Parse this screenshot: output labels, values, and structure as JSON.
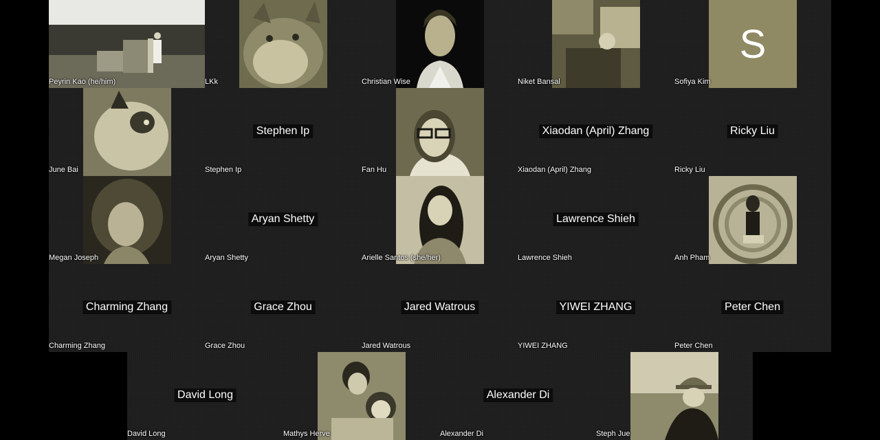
{
  "participants": [
    {
      "name": "Peyrin Kao (he/him)",
      "type": "video",
      "thumb": "stage"
    },
    {
      "name": "LKk",
      "type": "video",
      "thumb": "cat"
    },
    {
      "name": "Christian Wise",
      "type": "video",
      "thumb": "person-dark"
    },
    {
      "name": "Niket Bansal",
      "type": "video",
      "thumb": "outdoor"
    },
    {
      "name": "Sofiya Kim",
      "type": "avatar",
      "initial": "S"
    },
    {
      "name": "June Bai",
      "type": "video",
      "thumb": "cat-light"
    },
    {
      "name": "Stephen Ip",
      "type": "name",
      "display": "Stephen Ip"
    },
    {
      "name": "Fan Hu",
      "type": "video",
      "thumb": "person-glasses"
    },
    {
      "name": "Xiaodan (April) Zhang",
      "type": "name",
      "display": "Xiaodan (April) Zhang"
    },
    {
      "name": "Ricky Liu",
      "type": "name",
      "display": "Ricky Liu"
    },
    {
      "name": "Megan Joseph",
      "type": "video",
      "thumb": "person-curly"
    },
    {
      "name": "Aryan Shetty",
      "type": "name",
      "display": "Aryan Shetty"
    },
    {
      "name": "Arielle Santos (she/her)",
      "type": "video",
      "thumb": "person-hair"
    },
    {
      "name": "Lawrence Shieh",
      "type": "name",
      "display": "Lawrence Shieh"
    },
    {
      "name": "Anh Pham",
      "type": "video",
      "thumb": "person-seated"
    },
    {
      "name": "Charming Zhang",
      "type": "name",
      "display": "Charming Zhang"
    },
    {
      "name": "Grace Zhou",
      "type": "name",
      "display": "Grace Zhou"
    },
    {
      "name": "Jared Watrous",
      "type": "name",
      "display": "Jared Watrous"
    },
    {
      "name": "YIWEI ZHANG",
      "type": "name",
      "display": "YIWEI ZHANG"
    },
    {
      "name": "Peter Chen",
      "type": "name",
      "display": "Peter Chen"
    }
  ],
  "bottom_row": [
    {
      "name": "David Long",
      "type": "name",
      "display": "David Long"
    },
    {
      "name": "Mathys Herve",
      "type": "video",
      "thumb": "person-plush"
    },
    {
      "name": "Alexander Di",
      "type": "name",
      "display": "Alexander Di"
    },
    {
      "name": "Steph Jue",
      "type": "video",
      "thumb": "person-hat"
    }
  ],
  "colors": {
    "avatar_bg": "#8f8a63",
    "tile_bg": "#1e1e1e",
    "name_bg": "#0c0c0c"
  }
}
